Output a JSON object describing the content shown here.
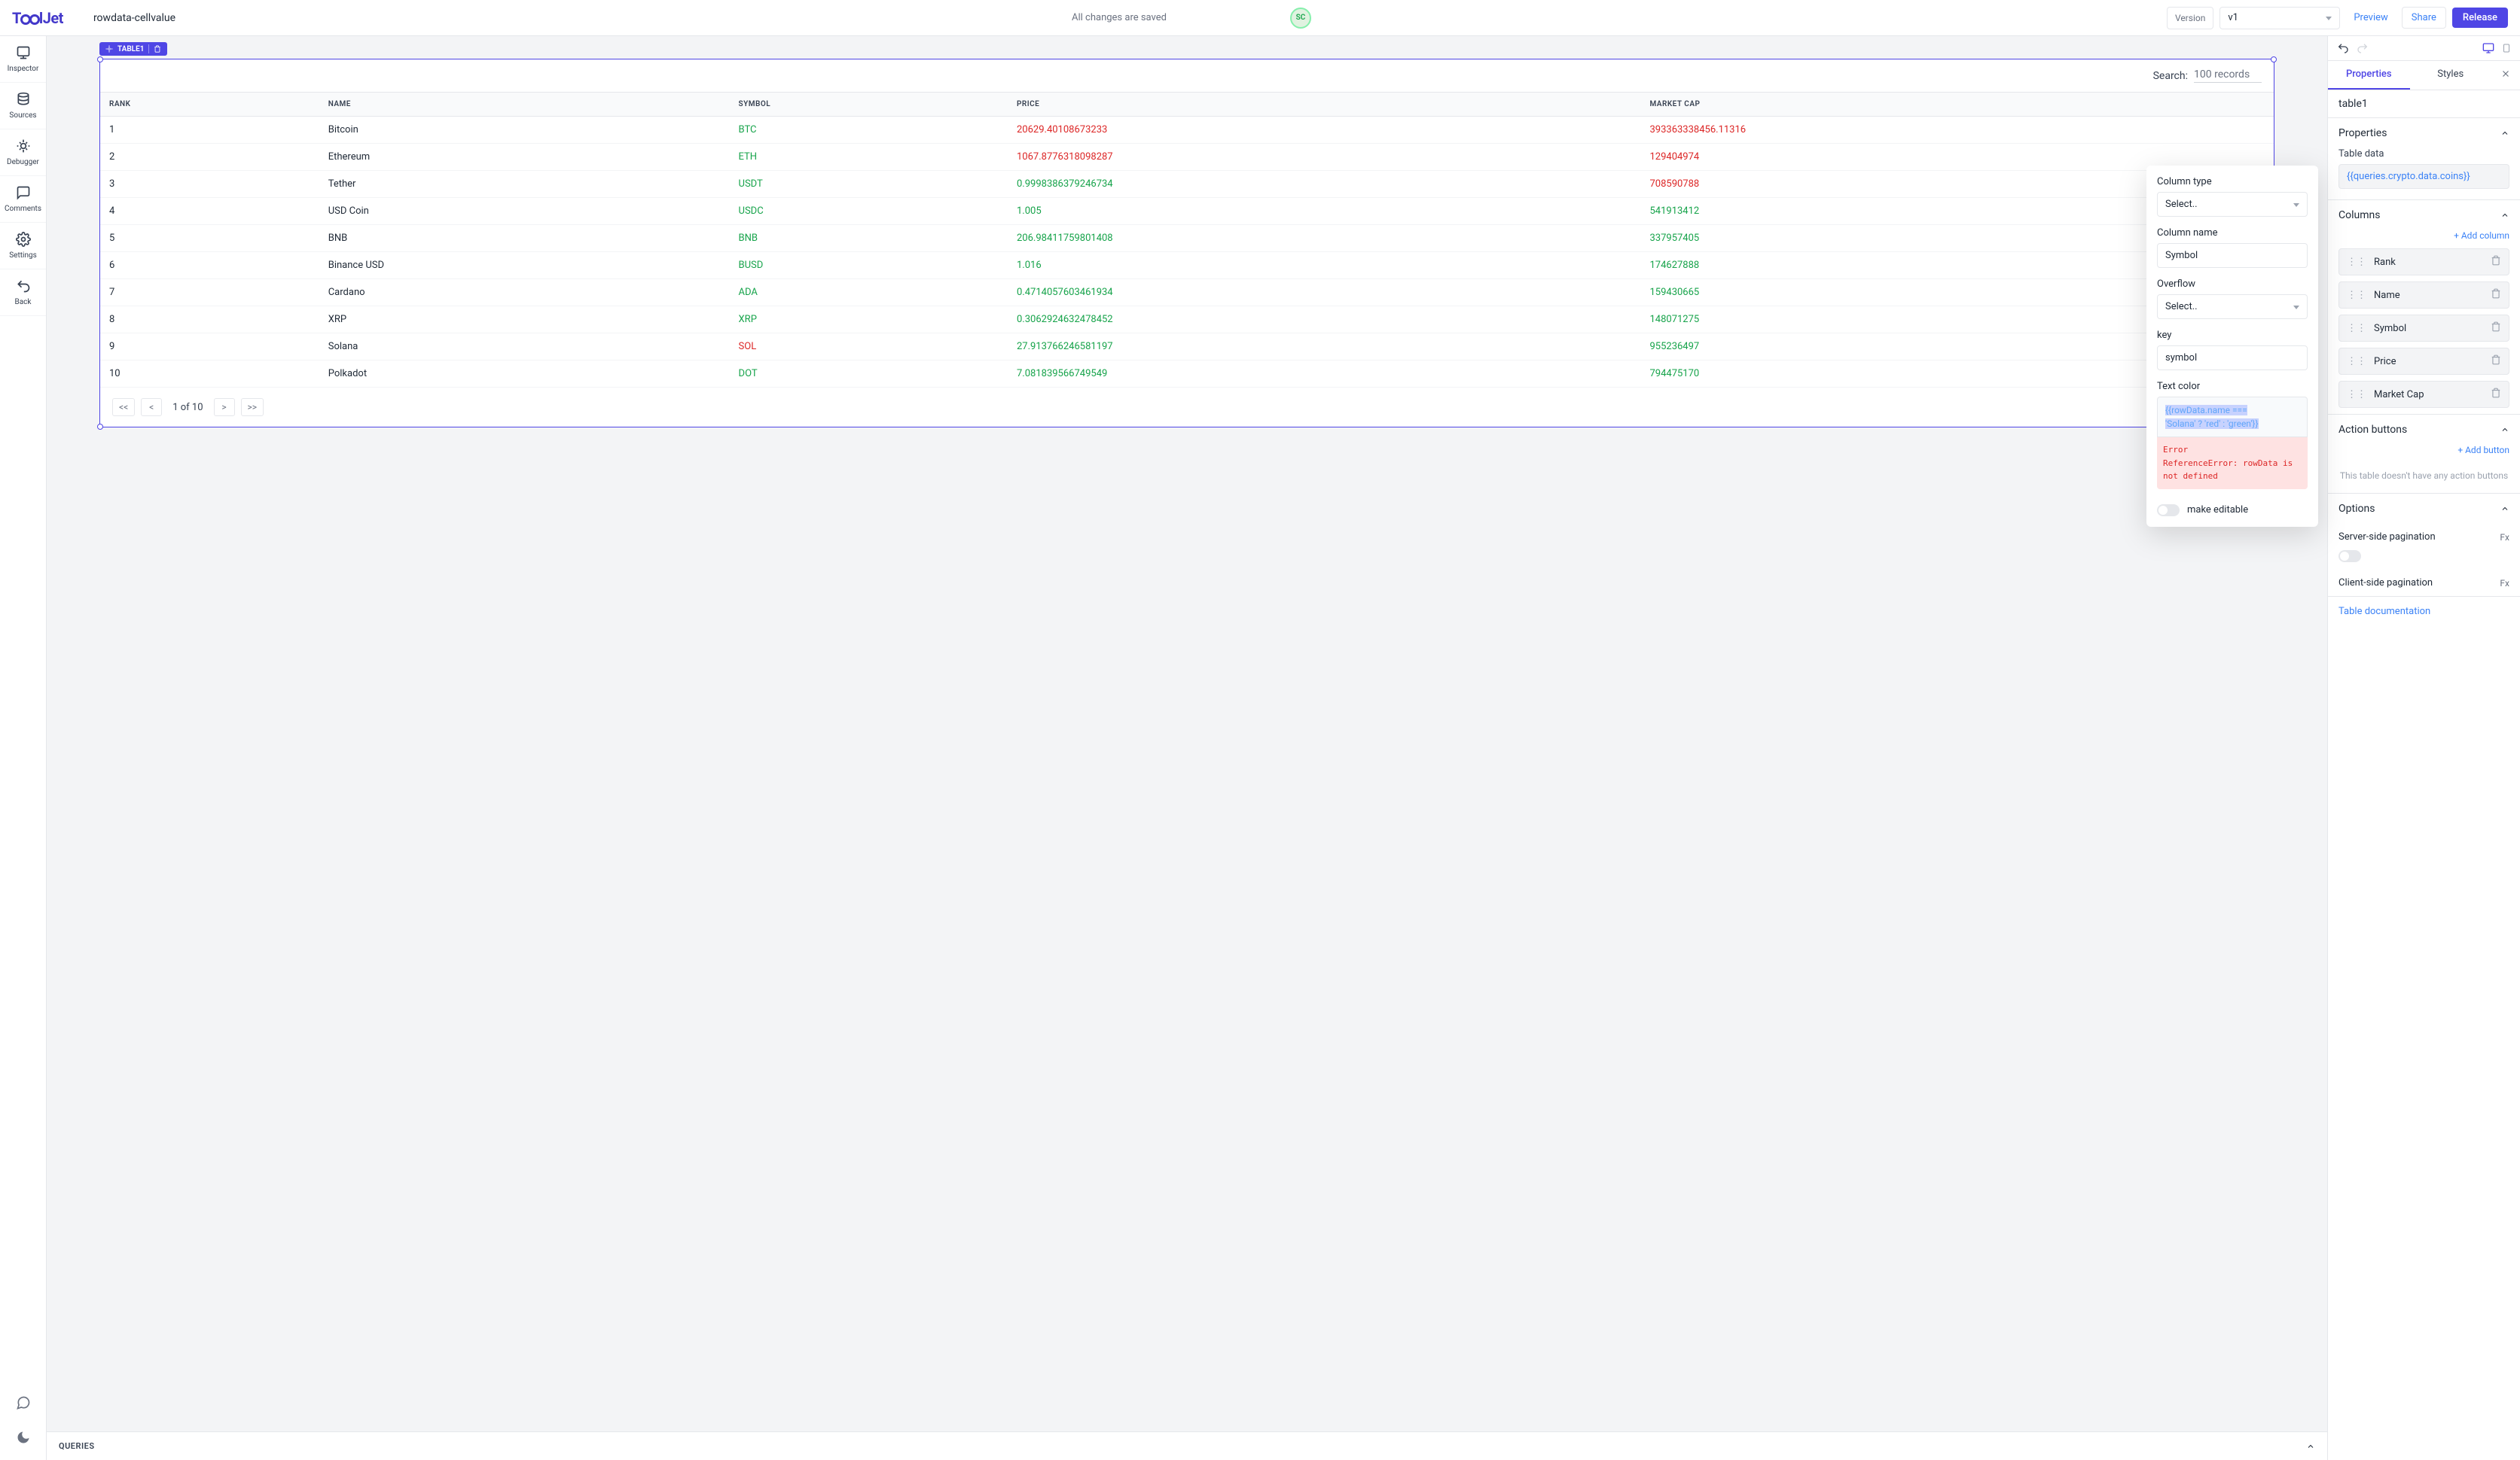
{
  "topbar": {
    "logo": "ToolJet",
    "project_name": "rowdata-cellvalue",
    "save_status": "All changes are saved",
    "avatar": "SC",
    "version_label": "Version",
    "version_value": "v1",
    "preview": "Preview",
    "share": "Share",
    "release": "Release"
  },
  "sidebar": {
    "items": [
      {
        "label": "Inspector"
      },
      {
        "label": "Sources"
      },
      {
        "label": "Debugger"
      },
      {
        "label": "Comments"
      },
      {
        "label": "Settings"
      },
      {
        "label": "Back"
      }
    ]
  },
  "widget": {
    "tag": "TABLE1",
    "search_label": "Search:",
    "search_placeholder": "100 records",
    "headers": [
      "RANK",
      "NAME",
      "SYMBOL",
      "PRICE",
      "MARKET CAP"
    ],
    "rows": [
      {
        "rank": "1",
        "name": "Bitcoin",
        "symbol": "BTC",
        "symbolColor": "green",
        "price": "20629.40108673233",
        "priceColor": "red",
        "cap": "393363338456.11316",
        "capColor": "red"
      },
      {
        "rank": "2",
        "name": "Ethereum",
        "symbol": "ETH",
        "symbolColor": "green",
        "price": "1067.8776318098287",
        "priceColor": "red",
        "cap": "129404974",
        "capColor": "red"
      },
      {
        "rank": "3",
        "name": "Tether",
        "symbol": "USDT",
        "symbolColor": "green",
        "price": "0.9998386379246734",
        "priceColor": "green",
        "cap": "708590788",
        "capColor": "red"
      },
      {
        "rank": "4",
        "name": "USD Coin",
        "symbol": "USDC",
        "symbolColor": "green",
        "price": "1.005",
        "priceColor": "green",
        "cap": "541913412",
        "capColor": "green"
      },
      {
        "rank": "5",
        "name": "BNB",
        "symbol": "BNB",
        "symbolColor": "green",
        "price": "206.98411759801408",
        "priceColor": "green",
        "cap": "337957405",
        "capColor": "green"
      },
      {
        "rank": "6",
        "name": "Binance USD",
        "symbol": "BUSD",
        "symbolColor": "green",
        "price": "1.016",
        "priceColor": "green",
        "cap": "174627888",
        "capColor": "green"
      },
      {
        "rank": "7",
        "name": "Cardano",
        "symbol": "ADA",
        "symbolColor": "green",
        "price": "0.4714057603461934",
        "priceColor": "green",
        "cap": "159430665",
        "capColor": "green"
      },
      {
        "rank": "8",
        "name": "XRP",
        "symbol": "XRP",
        "symbolColor": "green",
        "price": "0.3062924632478452",
        "priceColor": "green",
        "cap": "148071275",
        "capColor": "green"
      },
      {
        "rank": "9",
        "name": "Solana",
        "symbol": "SOL",
        "symbolColor": "red",
        "price": "27.913766246581197",
        "priceColor": "green",
        "cap": "955236497",
        "capColor": "green"
      },
      {
        "rank": "10",
        "name": "Polkadot",
        "symbol": "DOT",
        "symbolColor": "green",
        "price": "7.081839566749549",
        "priceColor": "green",
        "cap": "794475170",
        "capColor": "green"
      }
    ],
    "page_info": "1 of 10",
    "pg_first": "<<",
    "pg_prev": "<",
    "pg_next": ">",
    "pg_last": ">>"
  },
  "queries_title": "QUERIES",
  "panel": {
    "tab_properties": "Properties",
    "tab_styles": "Styles",
    "component_name": "table1",
    "sections": {
      "properties": "Properties",
      "table_data_label": "Table data",
      "table_data_value": "{{queries.crypto.data.coins}}",
      "columns": "Columns",
      "add_column": "+ Add column",
      "column_items": [
        "Rank",
        "Name",
        "Symbol",
        "Price",
        "Market Cap"
      ],
      "action_buttons": "Action buttons",
      "add_button": "+ Add button",
      "action_empty": "This table doesn't have any action buttons",
      "options": "Options",
      "server_pagination": "Server-side pagination",
      "client_pagination": "Client-side pagination",
      "fx": "Fx",
      "doc_link": "Table documentation"
    }
  },
  "popover": {
    "column_type_label": "Column type",
    "column_type_value": "Select..",
    "column_name_label": "Column name",
    "column_name_value": "Symbol",
    "overflow_label": "Overflow",
    "overflow_value": "Select..",
    "key_label": "key",
    "key_value": "symbol",
    "text_color_label": "Text color",
    "text_color_value_l1": "{{rowData.name ===",
    "text_color_value_l2": "'Solana' ? 'red' : 'green'}}",
    "error_title": "Error",
    "error_msg": "ReferenceError: rowData is not defined",
    "make_editable": "make editable"
  }
}
